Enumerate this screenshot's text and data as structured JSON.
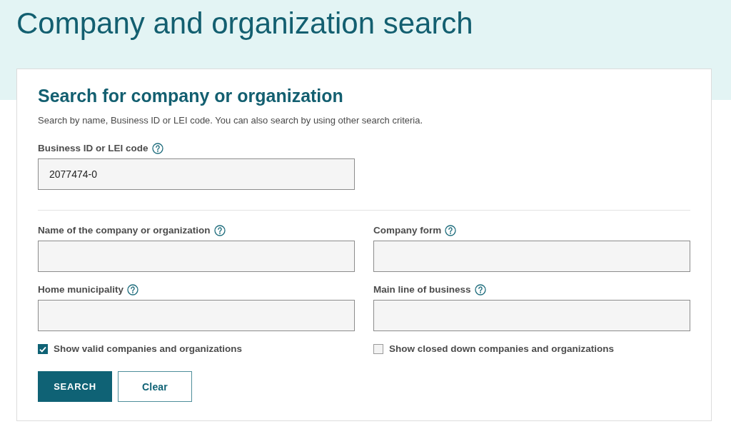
{
  "page": {
    "title": "Company and organization search"
  },
  "search_panel": {
    "title": "Search for company or organization",
    "description": "Search by name, Business ID or LEI code. You can also search by using other search criteria.",
    "id_field": {
      "label": "Business ID or LEI code",
      "value": "2077474-0"
    },
    "criteria_fields": [
      {
        "label": "Name of the company or organization"
      },
      {
        "label": "Company form"
      },
      {
        "label": "Home municipality"
      },
      {
        "label": "Main line of business"
      }
    ],
    "filters": [
      {
        "label": "Show valid companies and organizations",
        "checked": true
      },
      {
        "label": "Show closed down companies and organizations",
        "checked": false
      }
    ],
    "buttons": [
      {
        "label": "SEARCH",
        "kind": "primary"
      },
      {
        "label": "Clear",
        "kind": "secondary"
      }
    ]
  }
}
